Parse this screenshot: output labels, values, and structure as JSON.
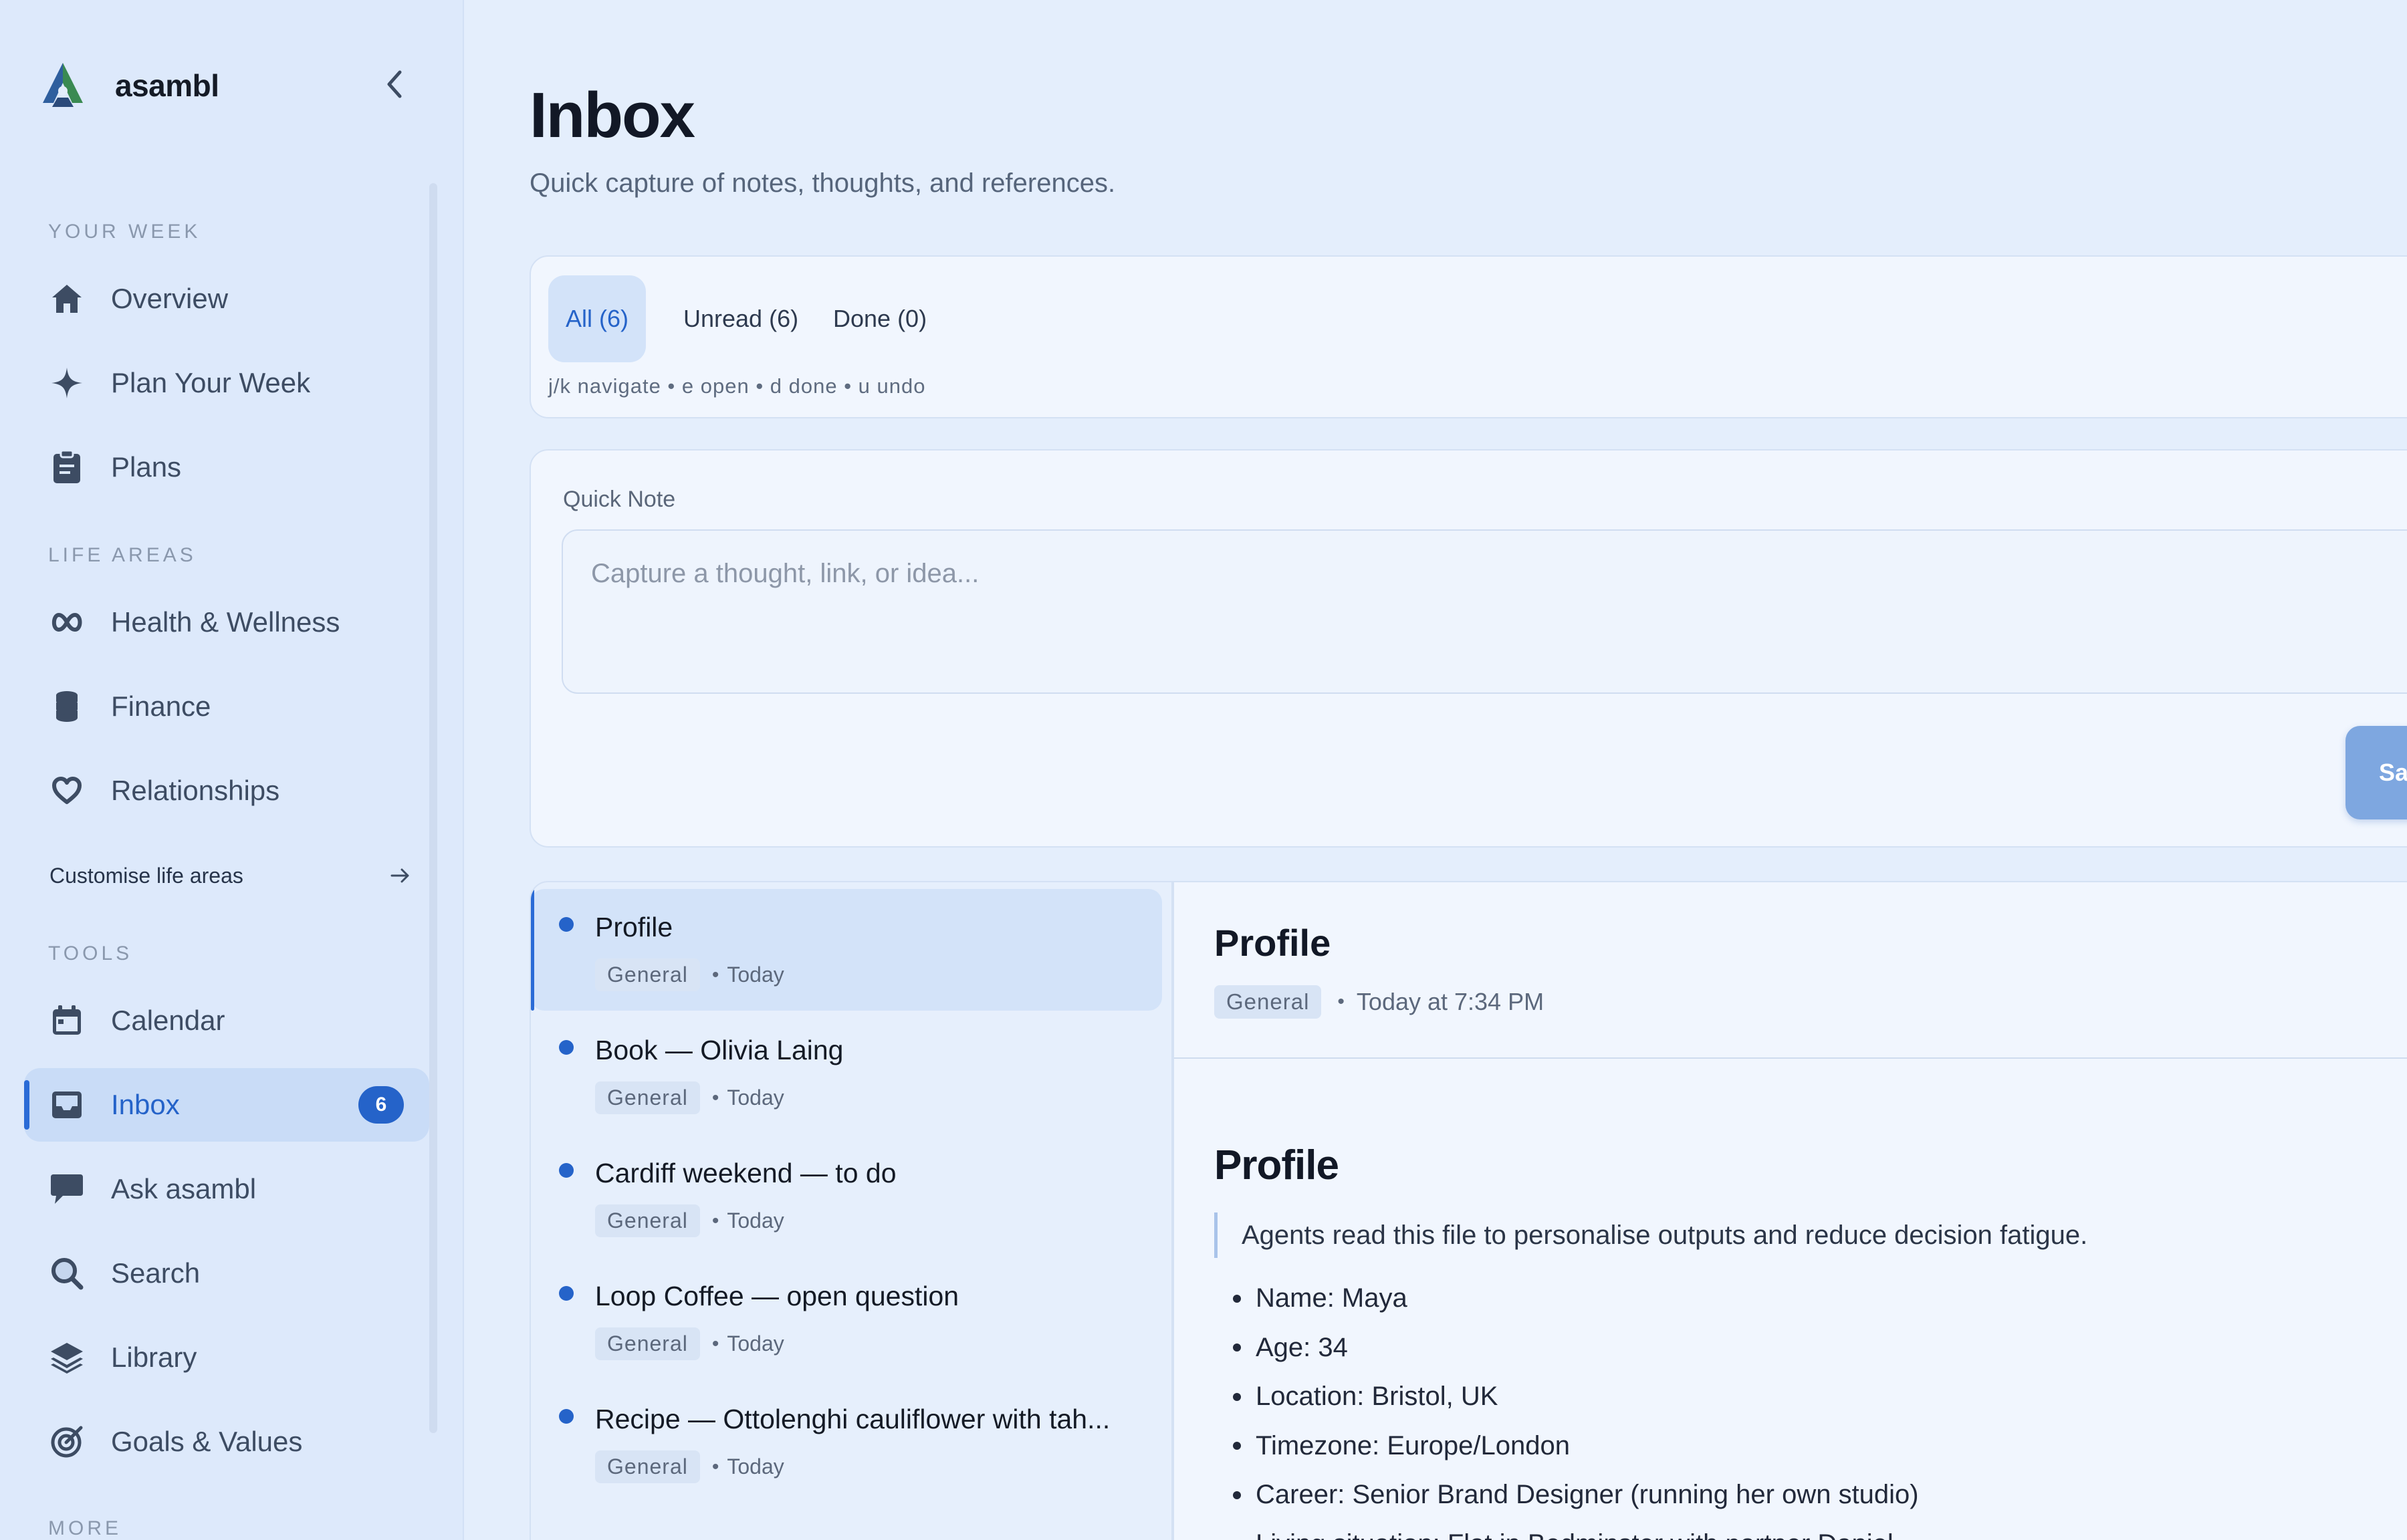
{
  "brand": {
    "name": "asambl"
  },
  "sidebar": {
    "sections": {
      "your_week": "YOUR WEEK",
      "life_areas": "LIFE AREAS",
      "tools": "TOOLS",
      "more": "MORE"
    },
    "your_week_items": [
      {
        "label": "Overview",
        "icon": "home-icon"
      },
      {
        "label": "Plan Your Week",
        "icon": "sparkle-icon"
      },
      {
        "label": "Plans",
        "icon": "clipboard-icon"
      }
    ],
    "life_area_items": [
      {
        "label": "Health & Wellness",
        "icon": "infinity-icon"
      },
      {
        "label": "Finance",
        "icon": "coins-icon"
      },
      {
        "label": "Relationships",
        "icon": "heart-icon"
      }
    ],
    "customise_label": "Customise life areas",
    "tool_items": [
      {
        "label": "Calendar",
        "icon": "calendar-icon"
      },
      {
        "label": "Inbox",
        "icon": "inbox-icon",
        "badge": "6",
        "active": true
      },
      {
        "label": "Ask asambl",
        "icon": "chat-icon"
      },
      {
        "label": "Search",
        "icon": "search-icon"
      },
      {
        "label": "Library",
        "icon": "layers-icon"
      },
      {
        "label": "Goals & Values",
        "icon": "target-icon"
      }
    ]
  },
  "page": {
    "title": "Inbox",
    "subtitle": "Quick capture of notes, thoughts, and references."
  },
  "filters": {
    "tabs": [
      {
        "label": "All (6)",
        "active": true
      },
      {
        "label": "Unread (6)",
        "active": false
      },
      {
        "label": "Done (0)",
        "active": false
      }
    ],
    "shortcuts": "j/k navigate • e open • d done • u undo"
  },
  "quick_note": {
    "label": "Quick Note",
    "placeholder": "Capture a thought, link, or idea...",
    "save_label": "Save Note"
  },
  "inbox_items": [
    {
      "title": "Profile",
      "tag": "General",
      "date": "Today",
      "selected": true
    },
    {
      "title": "Book — Olivia Laing",
      "tag": "General",
      "date": "Today"
    },
    {
      "title": "Cardiff weekend — to do",
      "tag": "General",
      "date": "Today"
    },
    {
      "title": "Loop Coffee — open question",
      "tag": "General",
      "date": "Today"
    },
    {
      "title": "Recipe — Ottolenghi cauliflower with tah...",
      "tag": "General",
      "date": "Today"
    }
  ],
  "detail": {
    "title": "Profile",
    "tag": "General",
    "when": "Today at 7:34 PM",
    "heading": "Profile",
    "quote": "Agents read this file to personalise outputs and reduce decision fatigue.",
    "bullets": [
      "Name: Maya",
      "Age: 34",
      "Location: Bristol, UK",
      "Timezone: Europe/London",
      "Career: Senior Brand Designer (running her own studio)",
      "Living situation: Flat in Bedminster with partner Daniel"
    ]
  },
  "colors": {
    "accent": "#2563c9",
    "background": "#e4eefc",
    "sidebar": "#dde9fb"
  }
}
